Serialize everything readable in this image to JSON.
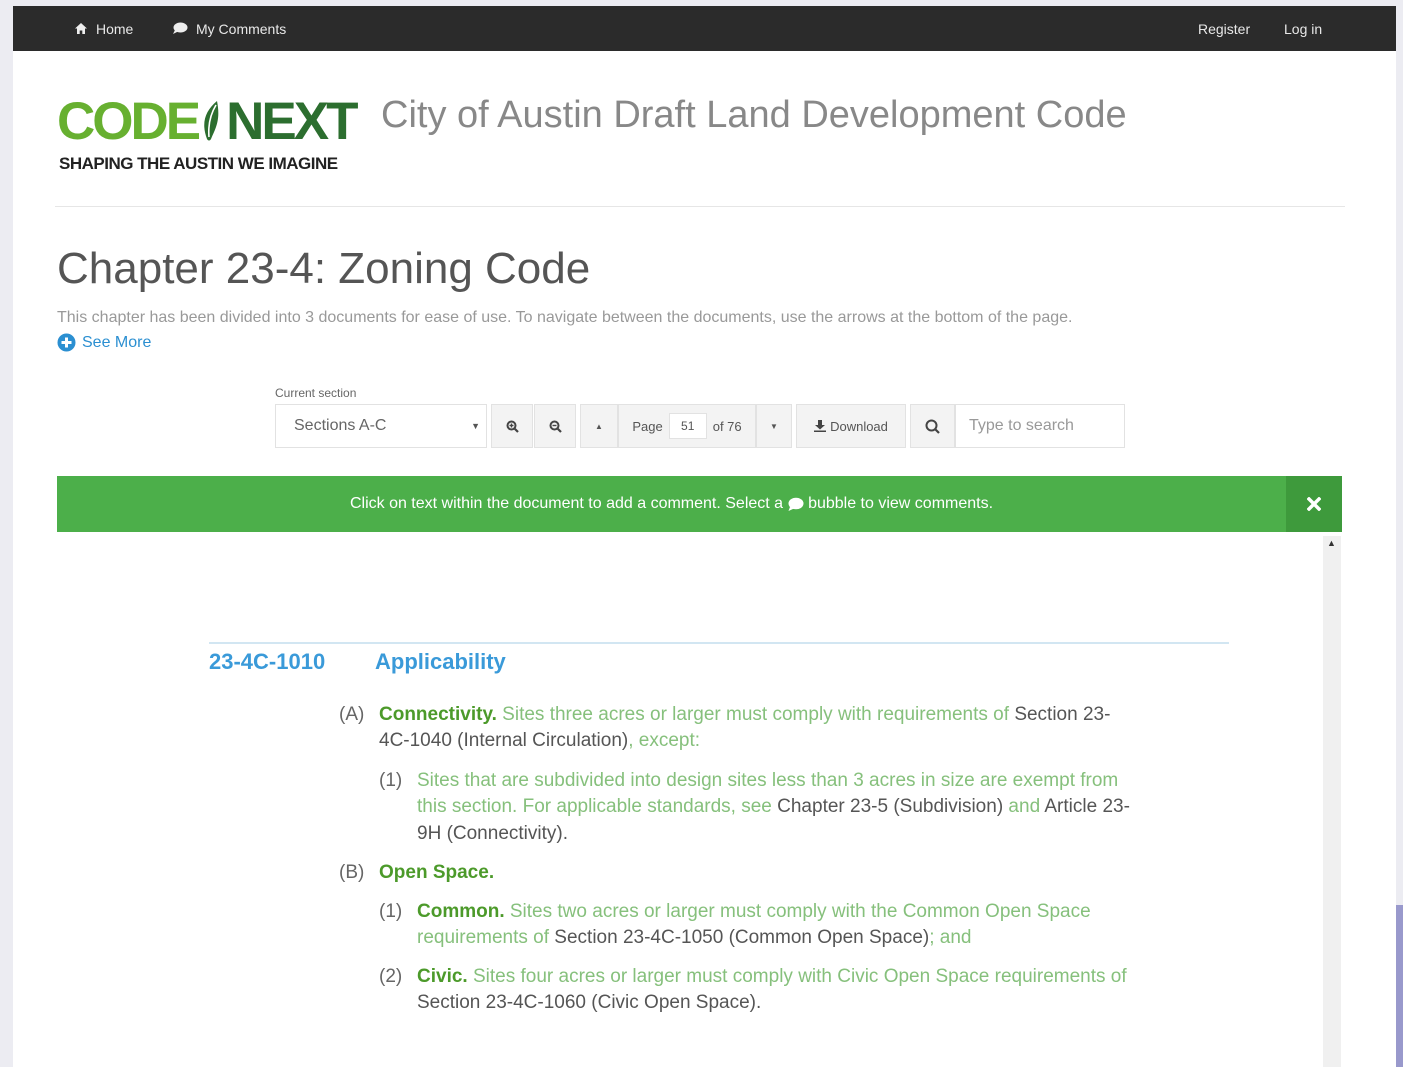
{
  "nav": {
    "home_label": "Home",
    "comments_label": "My Comments",
    "register_label": "Register",
    "login_label": "Log in"
  },
  "logo": {
    "word_code": "CODE",
    "word_next": "NEXT",
    "tagline": "SHAPING THE AUSTIN WE IMAGINE"
  },
  "site_title": "City of Austin Draft Land Development Code",
  "chapter": {
    "title": "Chapter 23-4: Zoning Code",
    "description": "This chapter has been divided into 3 documents for ease of use. To navigate between the documents, use the arrows at the bottom of the page.",
    "see_more": "See More"
  },
  "toolbar": {
    "section_label": "Current section",
    "section_value": "Sections A-C",
    "page_label": "Page",
    "page_value": "51",
    "page_of": "of 76",
    "download_label": "Download",
    "search_placeholder": "Type to search"
  },
  "banner": {
    "text_before": "Click on text within the document to add a comment. Select a",
    "text_after": "bubble to view comments."
  },
  "document": {
    "section_number": "23-4C-1010",
    "section_title": "Applicability",
    "a": {
      "label": "(A)",
      "term": "Connectivity.",
      "line1_text": " Sites three acres or larger must comply with requirements of ",
      "line1_ref": "Section 23-",
      "line2_ref": "4C-1040 (Internal Circulation)",
      "line2_text": ", except:"
    },
    "a1": {
      "label": "(1)",
      "line1": "Sites that are subdivided into design sites less than 3 acres in size are exempt from",
      "line2_text": "this section. For applicable standards, see ",
      "line2_ref": "Chapter 23-5 (Subdivision)",
      "line2_mid": " and ",
      "line2_ref2": "Article 23-",
      "line3_ref": "9H (Connectivity)",
      "line3_text": "."
    },
    "b": {
      "label": "(B)",
      "term": "Open Space."
    },
    "b1": {
      "label": "(1)",
      "term": "Common.",
      "line1_text": " Sites two acres or larger must comply with the Common Open Space",
      "line2_text": "requirements of ",
      "line2_ref": "Section 23-4C-1050 (Common Open Space)",
      "line2_end": "; and"
    },
    "b2": {
      "label": "(2)",
      "term": "Civic.",
      "line1_text": " Sites four acres or larger must comply with Civic Open Space requirements of",
      "line2_ref": "Section 23-4C-1060 (Civic Open Space)",
      "line2_end": "."
    }
  },
  "icons": {
    "home": "home-icon",
    "comment": "comment-icon",
    "zoom_in": "zoom-in-icon",
    "zoom_out": "zoom-out-icon",
    "download": "download-icon",
    "search": "search-icon",
    "close": "close-icon",
    "plus_circle": "plus-circle-icon"
  },
  "colors": {
    "topbar": "#2b2b2b",
    "banner": "#4caf4a",
    "logo_light_green": "#67b030",
    "logo_dark_green": "#2c6e2f",
    "link_blue": "#2b8fd1",
    "heading_blue": "#3a9ad9",
    "body_green": "#86c07c"
  }
}
